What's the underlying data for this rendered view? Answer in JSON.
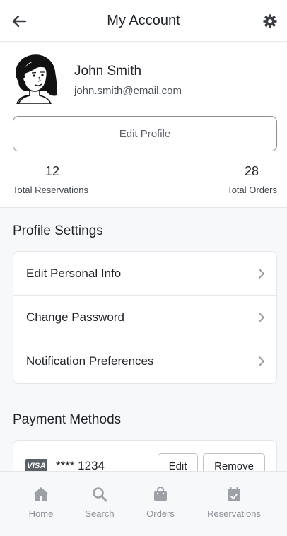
{
  "header": {
    "title": "My Account",
    "back_icon": "arrow-left-icon",
    "settings_icon": "gear-icon"
  },
  "profile": {
    "name": "John Smith",
    "email": "john.smith@email.com",
    "edit_label": "Edit Profile",
    "stats": [
      {
        "value": "12",
        "label": "Total Reservations"
      },
      {
        "value": "28",
        "label": "Total Orders"
      }
    ]
  },
  "settings": {
    "title": "Profile Settings",
    "items": [
      {
        "label": "Edit Personal Info"
      },
      {
        "label": "Change Password"
      },
      {
        "label": "Notification Preferences"
      }
    ]
  },
  "payment": {
    "title": "Payment Methods",
    "cards": [
      {
        "brand": "VISA",
        "number": "**** 1234",
        "edit_label": "Edit",
        "remove_label": "Remove"
      }
    ]
  },
  "nav": {
    "items": [
      {
        "label": "Home",
        "icon": "home-icon"
      },
      {
        "label": "Search",
        "icon": "search-icon"
      },
      {
        "label": "Orders",
        "icon": "shopping-bag-icon"
      },
      {
        "label": "Reservations",
        "icon": "calendar-check-icon"
      }
    ]
  },
  "colors": {
    "text": "#1f2328",
    "muted": "#8b9097",
    "border": "#e3e5e8",
    "background": "#f7f8fa"
  }
}
